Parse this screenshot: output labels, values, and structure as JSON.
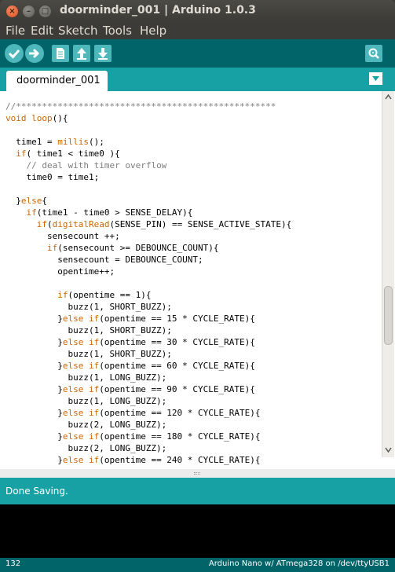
{
  "window": {
    "title": "doorminder_001 | Arduino 1.0.3",
    "controls": {
      "close": "×",
      "minimize": "–",
      "maximize": "□"
    }
  },
  "menu": [
    "File",
    "Edit",
    "Sketch",
    "Tools",
    "Help"
  ],
  "toolbar": {
    "buttons": [
      "verify-icon",
      "upload-icon",
      "new-icon",
      "open-icon",
      "save-icon",
      "serial-monitor-icon"
    ]
  },
  "tabs": [
    {
      "label": "doorminder_001",
      "active": true
    }
  ],
  "editor": {
    "lines": [
      [
        [
          "//**************************************************",
          "cm"
        ]
      ],
      [
        [
          "void ",
          "kw"
        ],
        [
          "loop",
          "kw"
        ],
        [
          "(){",
          ""
        ]
      ],
      [
        [
          "",
          ""
        ]
      ],
      [
        [
          "  time1 = ",
          ""
        ],
        [
          "millis",
          "kw"
        ],
        [
          "();",
          ""
        ]
      ],
      [
        [
          "  ",
          ""
        ],
        [
          "if",
          "kw"
        ],
        [
          "( time1 < time0 ){",
          ""
        ]
      ],
      [
        [
          "    ",
          ""
        ],
        [
          "// deal with timer overflow",
          "cm"
        ]
      ],
      [
        [
          "    time0 = time1;",
          ""
        ]
      ],
      [
        [
          "",
          ""
        ]
      ],
      [
        [
          "  }",
          ""
        ],
        [
          "else",
          "kw"
        ],
        [
          "{",
          ""
        ]
      ],
      [
        [
          "    ",
          ""
        ],
        [
          "if",
          "kw"
        ],
        [
          "(time1 - time0 > SENSE_DELAY){",
          ""
        ]
      ],
      [
        [
          "      ",
          ""
        ],
        [
          "if",
          "kw"
        ],
        [
          "(",
          ""
        ],
        [
          "digitalRead",
          "kw"
        ],
        [
          "(SENSE_PIN) == SENSE_ACTIVE_STATE){",
          ""
        ]
      ],
      [
        [
          "        sensecount ++;",
          ""
        ]
      ],
      [
        [
          "        ",
          ""
        ],
        [
          "if",
          "kw"
        ],
        [
          "(sensecount >= DEBOUNCE_COUNT){",
          ""
        ]
      ],
      [
        [
          "          sensecount = DEBOUNCE_COUNT;",
          ""
        ]
      ],
      [
        [
          "          opentime++;",
          ""
        ]
      ],
      [
        [
          "",
          ""
        ]
      ],
      [
        [
          "          ",
          ""
        ],
        [
          "if",
          "kw"
        ],
        [
          "(opentime == 1){",
          ""
        ]
      ],
      [
        [
          "            buzz(1, SHORT_BUZZ);",
          ""
        ]
      ],
      [
        [
          "          }",
          ""
        ],
        [
          "else if",
          "kw"
        ],
        [
          "(opentime == 15 * CYCLE_RATE){",
          ""
        ]
      ],
      [
        [
          "            buzz(1, SHORT_BUZZ);",
          ""
        ]
      ],
      [
        [
          "          }",
          ""
        ],
        [
          "else if",
          "kw"
        ],
        [
          "(opentime == 30 * CYCLE_RATE){",
          ""
        ]
      ],
      [
        [
          "            buzz(1, SHORT_BUZZ);",
          ""
        ]
      ],
      [
        [
          "          }",
          ""
        ],
        [
          "else if",
          "kw"
        ],
        [
          "(opentime == 60 * CYCLE_RATE){",
          ""
        ]
      ],
      [
        [
          "            buzz(1, LONG_BUZZ);",
          ""
        ]
      ],
      [
        [
          "          }",
          ""
        ],
        [
          "else if",
          "kw"
        ],
        [
          "(opentime == 90 * CYCLE_RATE){",
          ""
        ]
      ],
      [
        [
          "            buzz(1, LONG_BUZZ);",
          ""
        ]
      ],
      [
        [
          "          }",
          ""
        ],
        [
          "else if",
          "kw"
        ],
        [
          "(opentime == 120 * CYCLE_RATE){",
          ""
        ]
      ],
      [
        [
          "            buzz(2, LONG_BUZZ);",
          ""
        ]
      ],
      [
        [
          "          }",
          ""
        ],
        [
          "else if",
          "kw"
        ],
        [
          "(opentime == 180 * CYCLE_RATE){",
          ""
        ]
      ],
      [
        [
          "            buzz(2, LONG_BUZZ);",
          ""
        ]
      ],
      [
        [
          "          }",
          ""
        ],
        [
          "else if",
          "kw"
        ],
        [
          "(opentime == 240 * CYCLE_RATE){",
          ""
        ]
      ]
    ]
  },
  "status": {
    "message": "Done Saving."
  },
  "footer": {
    "line_number": "132",
    "board": "Arduino Nano w/ ATmega328 on /dev/ttyUSB1"
  },
  "colors": {
    "toolbar": "#006468",
    "tabbar": "#17a1a5",
    "keyword": "#cc6600",
    "comment": "#7e7e7e"
  }
}
